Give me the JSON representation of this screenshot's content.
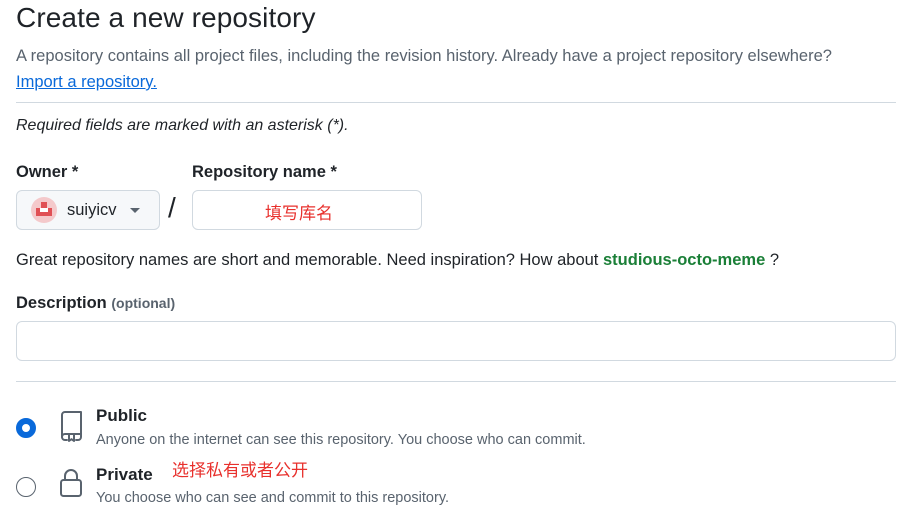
{
  "page": {
    "title": "Create a new repository",
    "subtitle": "A repository contains all project files, including the revision history. Already have a project repository elsewhere?",
    "import_link": "Import a repository.",
    "required_note": "Required fields are marked with an asterisk (*)."
  },
  "owner": {
    "label": "Owner *",
    "value": "suiyicv"
  },
  "separator": "/",
  "repo_name": {
    "label": "Repository name *",
    "value": "",
    "annotation": "填写库名"
  },
  "name_hint": {
    "text": "Great repository names are short and memorable. Need inspiration? How about",
    "suggestion": "studious-octo-meme",
    "end": "?"
  },
  "description": {
    "label": "Description",
    "optional": "(optional)",
    "value": ""
  },
  "visibility": {
    "annotation": "选择私有或者公开",
    "options": [
      {
        "title": "Public",
        "desc": "Anyone on the internet can see this repository. You choose who can commit.",
        "selected": true,
        "icon": "repo-icon"
      },
      {
        "title": "Private",
        "desc": "You choose who can see and commit to this repository.",
        "selected": false,
        "icon": "lock-icon"
      }
    ]
  },
  "colors": {
    "link": "#0969da",
    "suggestion": "#1a7f37",
    "annotation": "#e8302c",
    "radio_selected": "#0969da"
  }
}
